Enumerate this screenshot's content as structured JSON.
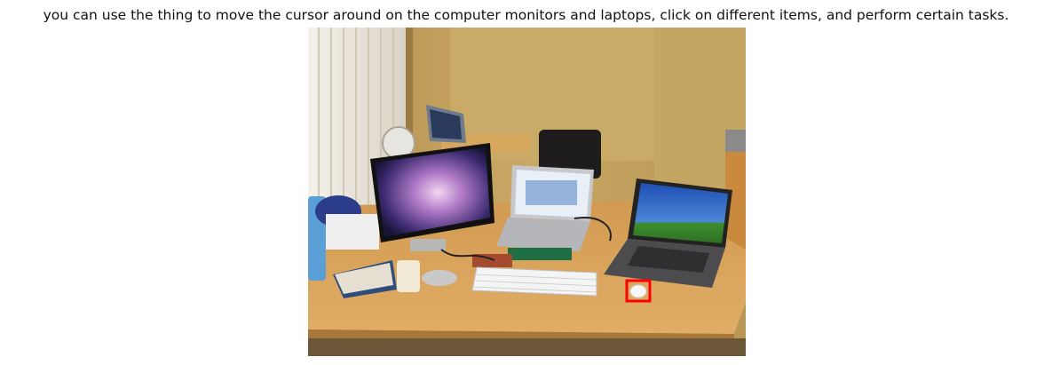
{
  "figure": {
    "caption": "you can use the thing to move the cursor around on the computer monitors and laptops, click on different items, and perform certain tasks."
  },
  "annotation": {
    "box_color": "#ff0000",
    "target": "mouse"
  }
}
